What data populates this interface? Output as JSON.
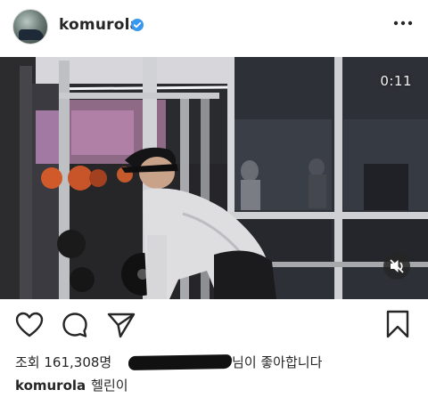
{
  "post": {
    "username": "komurola",
    "video_timer": "0:11",
    "likes_prefix": "조회",
    "views_count": "161,308명",
    "likes_suffix": "님이 좋아합니다",
    "caption_text": "헬린이"
  },
  "icons": {
    "avatar": "avatar-image",
    "verified": "verified-badge-icon",
    "more": "more-options-icon",
    "mute": "muted-speaker-icon",
    "like": "heart-icon",
    "comment": "comment-icon",
    "share": "paper-plane-icon",
    "save": "bookmark-icon"
  },
  "colors": {
    "verified_blue": "#3897f0",
    "text": "#262626",
    "redaction": "#111111"
  }
}
